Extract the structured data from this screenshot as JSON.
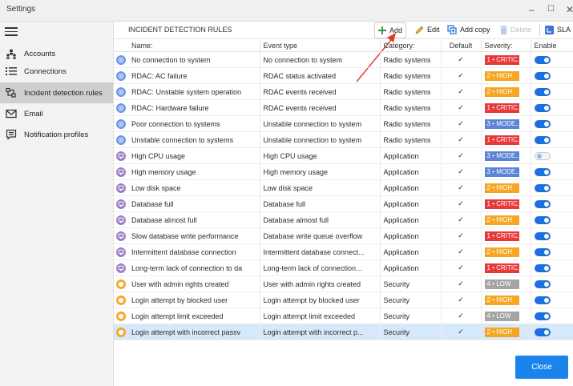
{
  "window": {
    "title": "Settings",
    "minimize": "–",
    "maximize": "☐",
    "close": "✕"
  },
  "sidebar": {
    "items": [
      {
        "label": "Accounts",
        "icon": "accounts-icon",
        "active": false
      },
      {
        "label": "Connections",
        "icon": "connections-icon",
        "active": false
      },
      {
        "label": "Incident detection rules",
        "icon": "incident-rules-icon",
        "active": true
      },
      {
        "label": "Email",
        "icon": "email-icon",
        "active": false
      },
      {
        "label": "Notification profiles",
        "icon": "notification-profiles-icon",
        "active": false
      }
    ]
  },
  "toolbar": {
    "panel_title": "INCIDENT DETECTION RULES",
    "add_label": "Add",
    "edit_label": "Edit",
    "add_copy_label": "Add copy",
    "delete_label": "Delete",
    "sla_label": "SLA"
  },
  "table": {
    "columns": [
      "Name:",
      "Event type",
      "Category:",
      "Default",
      "Severity:",
      "Enable"
    ],
    "rows": [
      {
        "icon": "radio",
        "name": "No connection to system",
        "event": "No connection to system",
        "category": "Radio systems",
        "default": "✓",
        "severity": "1 • CRITIC...",
        "level": 1,
        "enabled": true
      },
      {
        "icon": "radio",
        "name": "RDAC: AC failure",
        "event": "RDAC status activated",
        "category": "Radio systems",
        "default": "✓",
        "severity": "2 • HIGH",
        "level": 2,
        "enabled": true
      },
      {
        "icon": "radio",
        "name": "RDAC: Unstable system operation",
        "event": "RDAC events received",
        "category": "Radio systems",
        "default": "✓",
        "severity": "2 • HIGH",
        "level": 2,
        "enabled": true
      },
      {
        "icon": "radio",
        "name": "RDAC: Hardware failure",
        "event": "RDAC events received",
        "category": "Radio systems",
        "default": "✓",
        "severity": "1 • CRITIC...",
        "level": 1,
        "enabled": true
      },
      {
        "icon": "radio",
        "name": "Poor connection to systems",
        "event": "Unstable connection to system",
        "category": "Radio systems",
        "default": "✓",
        "severity": "3 • MODE...",
        "level": 3,
        "enabled": true
      },
      {
        "icon": "radio",
        "name": "Unstable connection to systems",
        "event": "Unstable connection to system",
        "category": "Radio systems",
        "default": "✓",
        "severity": "1 • CRITIC...",
        "level": 1,
        "enabled": true
      },
      {
        "icon": "app",
        "name": "High CPU usage",
        "event": "High CPU usage",
        "category": "Application",
        "default": "✓",
        "severity": "3 • MODE...",
        "level": 3,
        "enabled": false
      },
      {
        "icon": "app",
        "name": "High memory usage",
        "event": "High memory usage",
        "category": "Application",
        "default": "✓",
        "severity": "3 • MODE...",
        "level": 3,
        "enabled": true
      },
      {
        "icon": "app",
        "name": "Low disk space",
        "event": "Low disk space",
        "category": "Application",
        "default": "✓",
        "severity": "2 • HIGH",
        "level": 2,
        "enabled": true
      },
      {
        "icon": "app",
        "name": "Database full",
        "event": "Database full",
        "category": "Application",
        "default": "✓",
        "severity": "1 • CRITIC...",
        "level": 1,
        "enabled": true
      },
      {
        "icon": "app",
        "name": "Database almost full",
        "event": "Database almost full",
        "category": "Application",
        "default": "✓",
        "severity": "2 • HIGH",
        "level": 2,
        "enabled": true
      },
      {
        "icon": "app",
        "name": "Slow database write performance",
        "event": "Database write queue overflow",
        "category": "Application",
        "default": "✓",
        "severity": "1 • CRITIC...",
        "level": 1,
        "enabled": true
      },
      {
        "icon": "app",
        "name": "Intermittent database connection",
        "event": "Intermittent database connect...",
        "category": "Application",
        "default": "✓",
        "severity": "2 • HIGH",
        "level": 2,
        "enabled": true
      },
      {
        "icon": "app",
        "name": "Long-term lack of connection to da",
        "event": "Long-term lack of connection...",
        "category": "Application",
        "default": "✓",
        "severity": "1 • CRITIC...",
        "level": 1,
        "enabled": true
      },
      {
        "icon": "security",
        "name": "User with admin rights created",
        "event": "User with admin rights created",
        "category": "Security",
        "default": "✓",
        "severity": "4 • LOW",
        "level": 4,
        "enabled": true
      },
      {
        "icon": "security",
        "name": "Login attempt by blocked user",
        "event": "Login attempt by blocked user",
        "category": "Security",
        "default": "✓",
        "severity": "2 • HIGH",
        "level": 2,
        "enabled": true
      },
      {
        "icon": "security",
        "name": "Login attempt limit exceeded",
        "event": "Login attempt limit exceeded",
        "category": "Security",
        "default": "✓",
        "severity": "4 • LOW",
        "level": 4,
        "enabled": true
      },
      {
        "icon": "security",
        "name": "Login attempt with incorrect passv",
        "event": "Login attempt with incorrect p...",
        "category": "Security",
        "default": "✓",
        "severity": "2 • HIGH",
        "level": 2,
        "enabled": true,
        "selected": true
      }
    ]
  },
  "colors": {
    "sev_1": "#e8383a",
    "sev_2": "#f5a623",
    "sev_3": "#5b84d6",
    "sev_4": "#a5a5a5",
    "icon_radio": "#6f97e6",
    "icon_app": "#9b80c8",
    "icon_security": "#f5a623",
    "accent": "#1a84ec"
  },
  "footer": {
    "close_label": "Close"
  }
}
